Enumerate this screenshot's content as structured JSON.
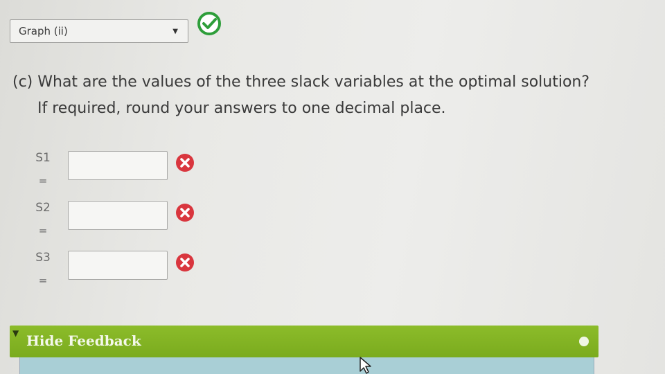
{
  "dropdown": {
    "selected": "Graph (ii)"
  },
  "question": {
    "line1": "(c) What are the values of the three slack variables at the optimal solution?",
    "line2": "If required, round your answers to one decimal place."
  },
  "slacks": [
    {
      "label": "S1",
      "eq": "=",
      "value": ""
    },
    {
      "label": "S2",
      "eq": "=",
      "value": ""
    },
    {
      "label": "S3",
      "eq": "=",
      "value": ""
    }
  ],
  "feedback": {
    "label": "Hide Feedback"
  },
  "colors": {
    "correct": "#2e9e3a",
    "incorrect": "#d9363e",
    "feedback_bar": "#82b424"
  }
}
